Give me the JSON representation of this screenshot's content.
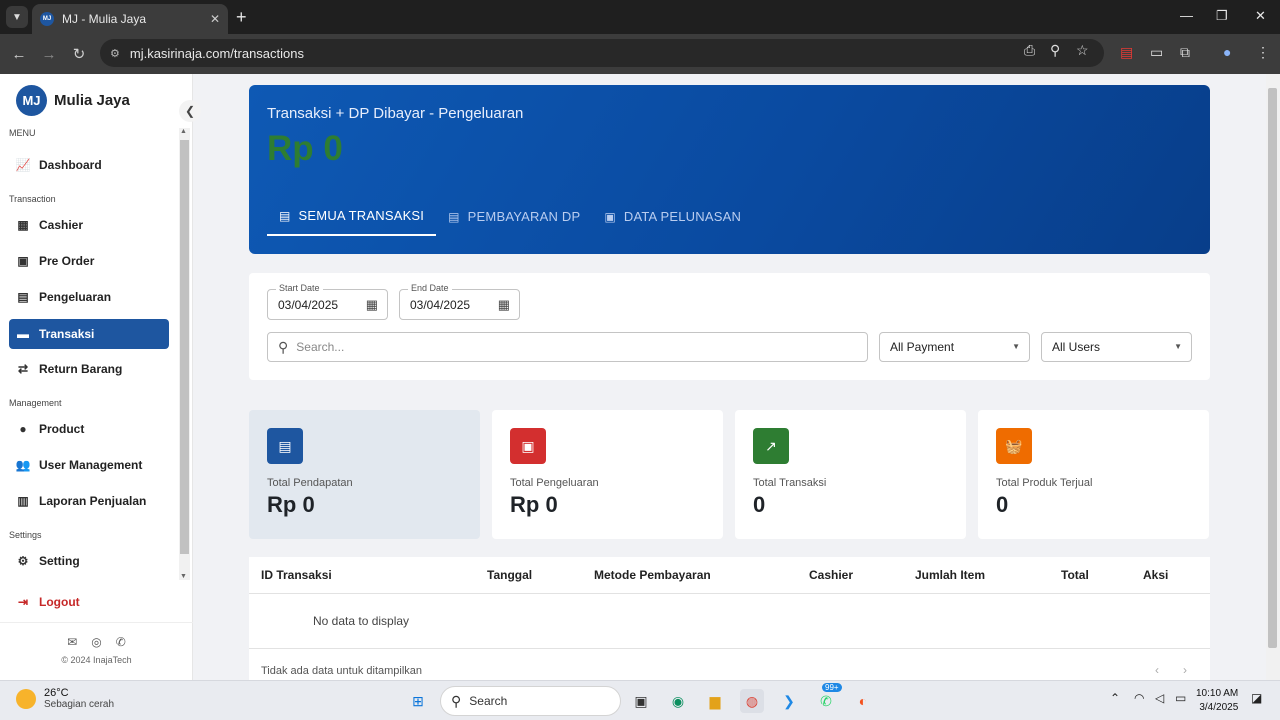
{
  "browser": {
    "tab_title": "MJ - Mulia Jaya",
    "tab_favicon": "MJ",
    "url": "mj.kasirinaja.com/transactions"
  },
  "sidebar": {
    "brand_logo": "MJ",
    "brand_name": "Mulia Jaya",
    "sections": {
      "menu": "MENU",
      "transaction": "Transaction",
      "management": "Management",
      "settings": "Settings"
    },
    "items": [
      {
        "label": "Dashboard",
        "icon": "chart-line-icon"
      },
      {
        "label": "Cashier",
        "icon": "cash-register-icon"
      },
      {
        "label": "Pre Order",
        "icon": "money-bill-icon"
      },
      {
        "label": "Pengeluaran",
        "icon": "wallet-icon"
      },
      {
        "label": "Transaksi",
        "icon": "credit-card-icon",
        "active": true
      },
      {
        "label": "Return Barang",
        "icon": "exchange-icon"
      },
      {
        "label": "Product",
        "icon": "product-icon"
      },
      {
        "label": "User Management",
        "icon": "users-icon"
      },
      {
        "label": "Laporan Penjualan",
        "icon": "report-icon"
      },
      {
        "label": "Setting",
        "icon": "gear-icon"
      },
      {
        "label": "Logout",
        "icon": "logout-icon"
      }
    ],
    "copyright": "© 2024 InajaTech"
  },
  "hero": {
    "subtitle": "Transaksi + DP Dibayar - Pengeluaran",
    "amount": "Rp 0",
    "tabs": [
      {
        "label": "SEMUA TRANSAKSI",
        "active": true
      },
      {
        "label": "PEMBAYARAN DP",
        "active": false
      },
      {
        "label": "DATA PELUNASAN",
        "active": false
      }
    ]
  },
  "filters": {
    "start_date_label": "Start Date",
    "start_date": "03/04/2025",
    "end_date_label": "End Date",
    "end_date": "03/04/2025",
    "search_placeholder": "Search...",
    "payment_select": "All Payment",
    "users_select": "All Users"
  },
  "stats": [
    {
      "label": "Total Pendapatan",
      "value": "Rp 0",
      "color": "#1e56a0"
    },
    {
      "label": "Total Pengeluaran",
      "value": "Rp 0",
      "color": "#d32f2f"
    },
    {
      "label": "Total Transaksi",
      "value": "0",
      "color": "#2e7d32"
    },
    {
      "label": "Total Produk Terjual",
      "value": "0",
      "color": "#ef6c00"
    }
  ],
  "table": {
    "columns": [
      "ID Transaksi",
      "Tanggal",
      "Metode Pembayaran",
      "Cashier",
      "Jumlah Item",
      "Total",
      "Aksi"
    ],
    "empty_text": "No data to display",
    "footer_text": "Tidak ada data untuk ditampilkan"
  },
  "taskbar": {
    "weather_temp": "26°C",
    "weather_desc": "Sebagian cerah",
    "search_label": "Search",
    "whatsapp_badge": "99+",
    "time": "10:10 AM",
    "date": "3/4/2025"
  }
}
